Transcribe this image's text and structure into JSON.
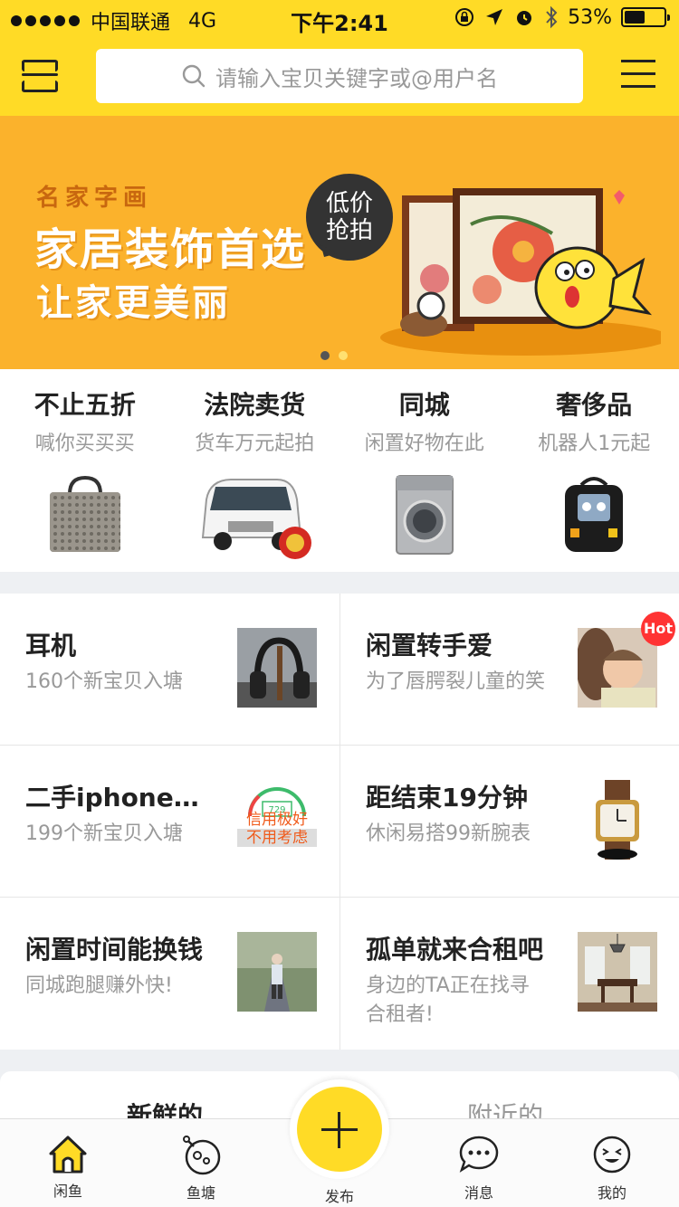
{
  "status_bar": {
    "carrier": "中国联通",
    "network": "4G",
    "time": "下午2:41",
    "battery": "53%",
    "battery_level": 0.53
  },
  "header": {
    "search_placeholder": "请输入宝贝关键字或@用户名"
  },
  "banner": {
    "subtitle": "名家字画",
    "title": "家居装饰首选",
    "tagline": "让家更美丽",
    "bubble_line1": "低价",
    "bubble_line2": "抢拍"
  },
  "categories": [
    {
      "title": "不止五折",
      "subtitle": "喊你买买买",
      "icon": "handbag-icon"
    },
    {
      "title": "法院卖货",
      "subtitle": "货车万元起拍",
      "icon": "van-icon"
    },
    {
      "title": "同城",
      "subtitle": "闲置好物在此",
      "icon": "washing-machine-icon"
    },
    {
      "title": "奢侈品",
      "subtitle": "机器人1元起",
      "icon": "backpack-icon"
    }
  ],
  "cards": [
    {
      "title": "耳机",
      "subtitle": "160个新宝贝入塘",
      "icon": "headphones-photo"
    },
    {
      "title": "闲置转手爱",
      "subtitle": "为了唇腭裂儿童的笑",
      "icon": "child-photo",
      "badge": "Hot"
    },
    {
      "title": "二手iphone…",
      "subtitle": "199个新宝贝入塘",
      "icon": "credit-score-image",
      "image_text_1": "信用极好",
      "image_text_2": "不用考虑",
      "score": "729"
    },
    {
      "title": "距结束19分钟",
      "subtitle": "休闲易搭99新腕表",
      "icon": "watch-photo"
    },
    {
      "title": "闲置时间能换钱",
      "subtitle": "同城跑腿赚外快!",
      "icon": "runner-photo"
    },
    {
      "title": "孤单就来合租吧",
      "subtitle": "身边的TA正在找寻合租者!",
      "icon": "room-photo"
    }
  ],
  "feed_tabs": {
    "left": "新鲜的",
    "right": "附近的"
  },
  "tabbar": {
    "items": [
      {
        "label": "闲鱼",
        "icon": "home-icon"
      },
      {
        "label": "鱼塘",
        "icon": "pond-icon"
      },
      {
        "label": "发布",
        "icon": "plus-icon"
      },
      {
        "label": "消息",
        "icon": "message-icon"
      },
      {
        "label": "我的",
        "icon": "profile-face-icon"
      }
    ]
  },
  "colors": {
    "brand_yellow": "#ffdb26",
    "banner_orange": "#fbb22c",
    "hot_red": "#ff3333"
  }
}
